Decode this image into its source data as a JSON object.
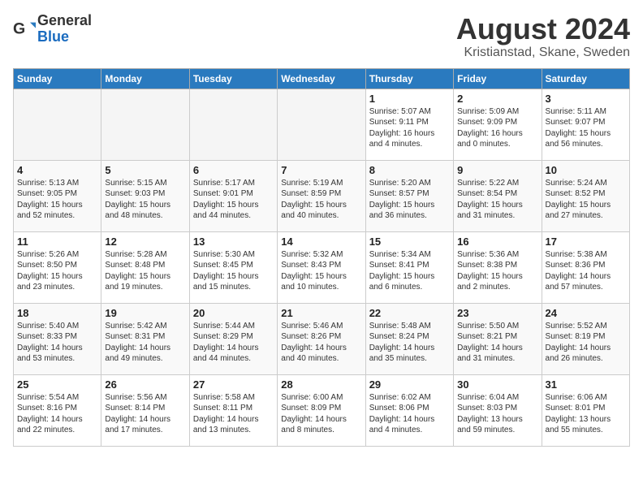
{
  "logo": {
    "general": "General",
    "blue": "Blue"
  },
  "title": {
    "month_year": "August 2024",
    "location": "Kristianstad, Skane, Sweden"
  },
  "days_of_week": [
    "Sunday",
    "Monday",
    "Tuesday",
    "Wednesday",
    "Thursday",
    "Friday",
    "Saturday"
  ],
  "weeks": [
    [
      {
        "day": "",
        "info": ""
      },
      {
        "day": "",
        "info": ""
      },
      {
        "day": "",
        "info": ""
      },
      {
        "day": "",
        "info": ""
      },
      {
        "day": "1",
        "info": "Sunrise: 5:07 AM\nSunset: 9:11 PM\nDaylight: 16 hours\nand 4 minutes."
      },
      {
        "day": "2",
        "info": "Sunrise: 5:09 AM\nSunset: 9:09 PM\nDaylight: 16 hours\nand 0 minutes."
      },
      {
        "day": "3",
        "info": "Sunrise: 5:11 AM\nSunset: 9:07 PM\nDaylight: 15 hours\nand 56 minutes."
      }
    ],
    [
      {
        "day": "4",
        "info": "Sunrise: 5:13 AM\nSunset: 9:05 PM\nDaylight: 15 hours\nand 52 minutes."
      },
      {
        "day": "5",
        "info": "Sunrise: 5:15 AM\nSunset: 9:03 PM\nDaylight: 15 hours\nand 48 minutes."
      },
      {
        "day": "6",
        "info": "Sunrise: 5:17 AM\nSunset: 9:01 PM\nDaylight: 15 hours\nand 44 minutes."
      },
      {
        "day": "7",
        "info": "Sunrise: 5:19 AM\nSunset: 8:59 PM\nDaylight: 15 hours\nand 40 minutes."
      },
      {
        "day": "8",
        "info": "Sunrise: 5:20 AM\nSunset: 8:57 PM\nDaylight: 15 hours\nand 36 minutes."
      },
      {
        "day": "9",
        "info": "Sunrise: 5:22 AM\nSunset: 8:54 PM\nDaylight: 15 hours\nand 31 minutes."
      },
      {
        "day": "10",
        "info": "Sunrise: 5:24 AM\nSunset: 8:52 PM\nDaylight: 15 hours\nand 27 minutes."
      }
    ],
    [
      {
        "day": "11",
        "info": "Sunrise: 5:26 AM\nSunset: 8:50 PM\nDaylight: 15 hours\nand 23 minutes."
      },
      {
        "day": "12",
        "info": "Sunrise: 5:28 AM\nSunset: 8:48 PM\nDaylight: 15 hours\nand 19 minutes."
      },
      {
        "day": "13",
        "info": "Sunrise: 5:30 AM\nSunset: 8:45 PM\nDaylight: 15 hours\nand 15 minutes."
      },
      {
        "day": "14",
        "info": "Sunrise: 5:32 AM\nSunset: 8:43 PM\nDaylight: 15 hours\nand 10 minutes."
      },
      {
        "day": "15",
        "info": "Sunrise: 5:34 AM\nSunset: 8:41 PM\nDaylight: 15 hours\nand 6 minutes."
      },
      {
        "day": "16",
        "info": "Sunrise: 5:36 AM\nSunset: 8:38 PM\nDaylight: 15 hours\nand 2 minutes."
      },
      {
        "day": "17",
        "info": "Sunrise: 5:38 AM\nSunset: 8:36 PM\nDaylight: 14 hours\nand 57 minutes."
      }
    ],
    [
      {
        "day": "18",
        "info": "Sunrise: 5:40 AM\nSunset: 8:33 PM\nDaylight: 14 hours\nand 53 minutes."
      },
      {
        "day": "19",
        "info": "Sunrise: 5:42 AM\nSunset: 8:31 PM\nDaylight: 14 hours\nand 49 minutes."
      },
      {
        "day": "20",
        "info": "Sunrise: 5:44 AM\nSunset: 8:29 PM\nDaylight: 14 hours\nand 44 minutes."
      },
      {
        "day": "21",
        "info": "Sunrise: 5:46 AM\nSunset: 8:26 PM\nDaylight: 14 hours\nand 40 minutes."
      },
      {
        "day": "22",
        "info": "Sunrise: 5:48 AM\nSunset: 8:24 PM\nDaylight: 14 hours\nand 35 minutes."
      },
      {
        "day": "23",
        "info": "Sunrise: 5:50 AM\nSunset: 8:21 PM\nDaylight: 14 hours\nand 31 minutes."
      },
      {
        "day": "24",
        "info": "Sunrise: 5:52 AM\nSunset: 8:19 PM\nDaylight: 14 hours\nand 26 minutes."
      }
    ],
    [
      {
        "day": "25",
        "info": "Sunrise: 5:54 AM\nSunset: 8:16 PM\nDaylight: 14 hours\nand 22 minutes."
      },
      {
        "day": "26",
        "info": "Sunrise: 5:56 AM\nSunset: 8:14 PM\nDaylight: 14 hours\nand 17 minutes."
      },
      {
        "day": "27",
        "info": "Sunrise: 5:58 AM\nSunset: 8:11 PM\nDaylight: 14 hours\nand 13 minutes."
      },
      {
        "day": "28",
        "info": "Sunrise: 6:00 AM\nSunset: 8:09 PM\nDaylight: 14 hours\nand 8 minutes."
      },
      {
        "day": "29",
        "info": "Sunrise: 6:02 AM\nSunset: 8:06 PM\nDaylight: 14 hours\nand 4 minutes."
      },
      {
        "day": "30",
        "info": "Sunrise: 6:04 AM\nSunset: 8:03 PM\nDaylight: 13 hours\nand 59 minutes."
      },
      {
        "day": "31",
        "info": "Sunrise: 6:06 AM\nSunset: 8:01 PM\nDaylight: 13 hours\nand 55 minutes."
      }
    ]
  ]
}
